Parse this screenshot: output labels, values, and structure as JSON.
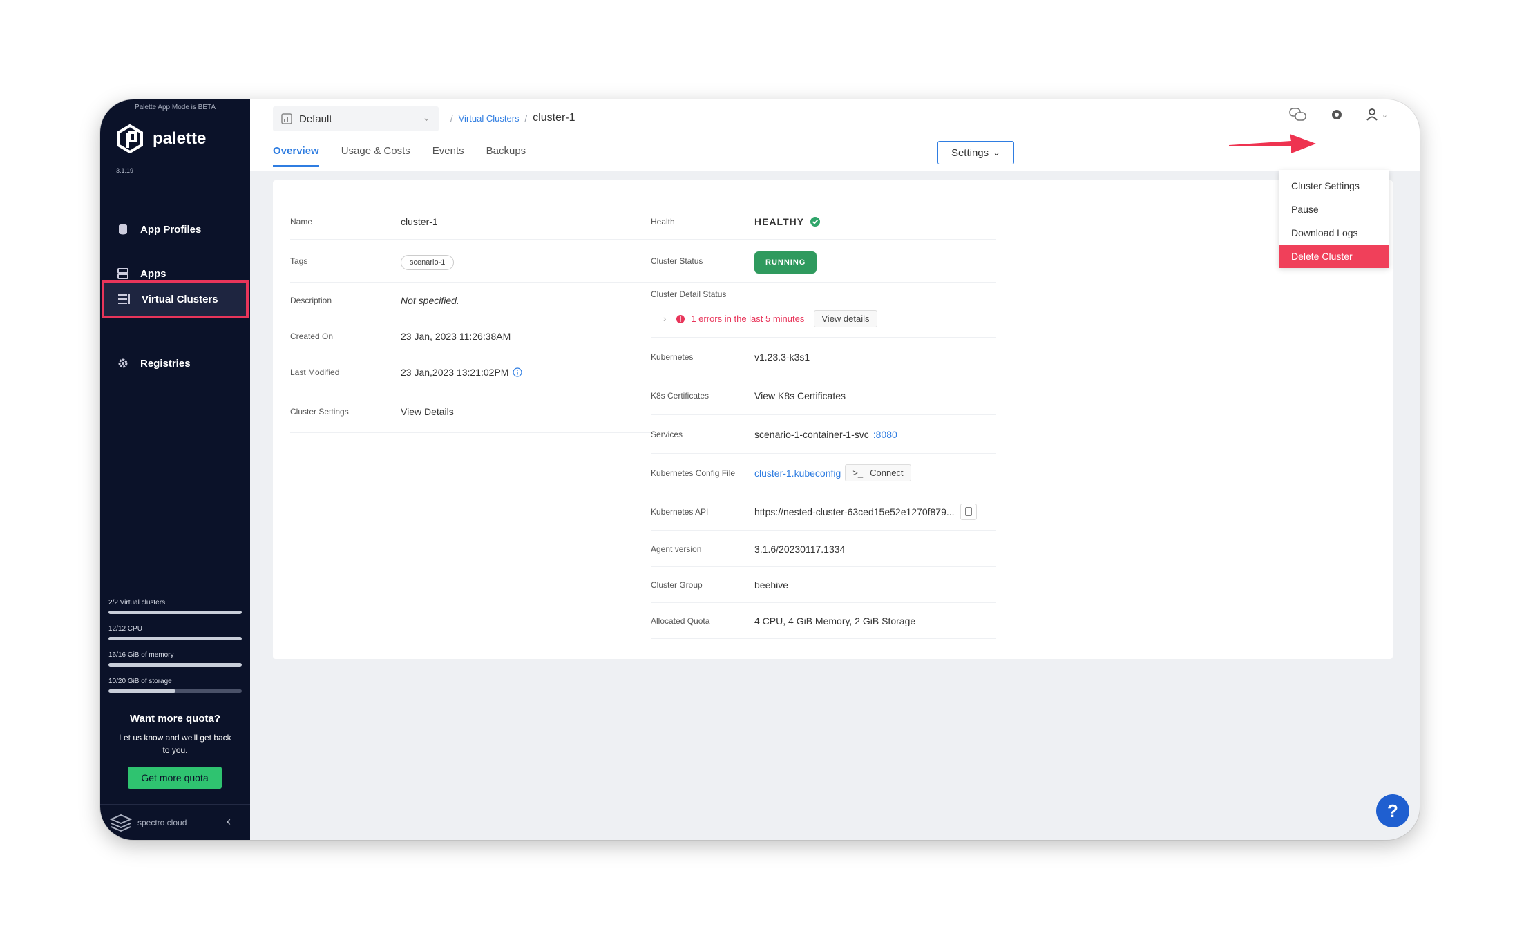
{
  "sidebar": {
    "beta_notice": "Palette App Mode is BETA",
    "logo_text": "palette",
    "version": "3.1.19",
    "items": [
      {
        "label": "App Profiles",
        "icon": "database-icon"
      },
      {
        "label": "Apps",
        "icon": "server-icon"
      },
      {
        "label": "Virtual Clusters",
        "icon": "list-icon"
      },
      {
        "label": "Registries",
        "icon": "gear-icon"
      }
    ],
    "quotas": [
      {
        "label": "2/2 Virtual clusters",
        "fraction": 1.0
      },
      {
        "label": "12/12 CPU",
        "fraction": 1.0
      },
      {
        "label": "16/16 GiB of memory",
        "fraction": 1.0
      },
      {
        "label": "10/20 GiB of storage",
        "fraction": 0.5
      }
    ],
    "want_title": "Want more quota?",
    "want_text": "Let us know and we'll get back to you.",
    "get_quota_label": "Get more quota",
    "footer_brand": "spectro cloud"
  },
  "header": {
    "project": "Default",
    "breadcrumb_link": "Virtual Clusters",
    "breadcrumb_current": "cluster-1",
    "tabs": [
      "Overview",
      "Usage & Costs",
      "Events",
      "Backups"
    ],
    "settings_label": "Settings"
  },
  "dropdown": {
    "items": [
      "Cluster Settings",
      "Pause",
      "Download Logs",
      "Delete Cluster"
    ]
  },
  "overview": {
    "left": {
      "name_label": "Name",
      "name_value": "cluster-1",
      "tags_label": "Tags",
      "tag_value": "scenario-1",
      "description_label": "Description",
      "description_value": "Not specified.",
      "created_label": "Created On",
      "created_value": "23 Jan, 2023 11:26:38AM",
      "modified_label": "Last Modified",
      "modified_value": "23 Jan,2023 13:21:02PM",
      "settings_label": "Cluster Settings",
      "settings_link": "View Details"
    },
    "right": {
      "health_label": "Health",
      "health_value": "HEALTHY",
      "status_label": "Cluster Status",
      "status_value": "RUNNING",
      "detail_status_label": "Cluster Detail Status",
      "errors_text": "1 errors in the last 5 minutes",
      "view_details": "View details",
      "kubernetes_label": "Kubernetes",
      "kubernetes_value": "v1.23.3-k3s1",
      "certs_label": "K8s Certificates",
      "certs_link": "View K8s Certificates",
      "services_label": "Services",
      "services_value": "scenario-1-container-1-svc",
      "services_port": ":8080",
      "config_label": "Kubernetes Config File",
      "config_link": "cluster-1.kubeconfig",
      "connect_label": "Connect",
      "api_label": "Kubernetes API",
      "api_value": "https://nested-cluster-63ced15e52e1270f879...",
      "agent_label": "Agent version",
      "agent_value": "3.1.6/20230117.1334",
      "group_label": "Cluster Group",
      "group_value": "beehive",
      "quota_label": "Allocated Quota",
      "quota_value": "4 CPU, 4 GiB Memory, 2 GiB Storage"
    }
  },
  "help_label": "?",
  "colors": {
    "sidebar_bg": "#0b1229",
    "accent": "#2f7de1",
    "danger": "#f0405a",
    "success": "#2f9a5e"
  }
}
